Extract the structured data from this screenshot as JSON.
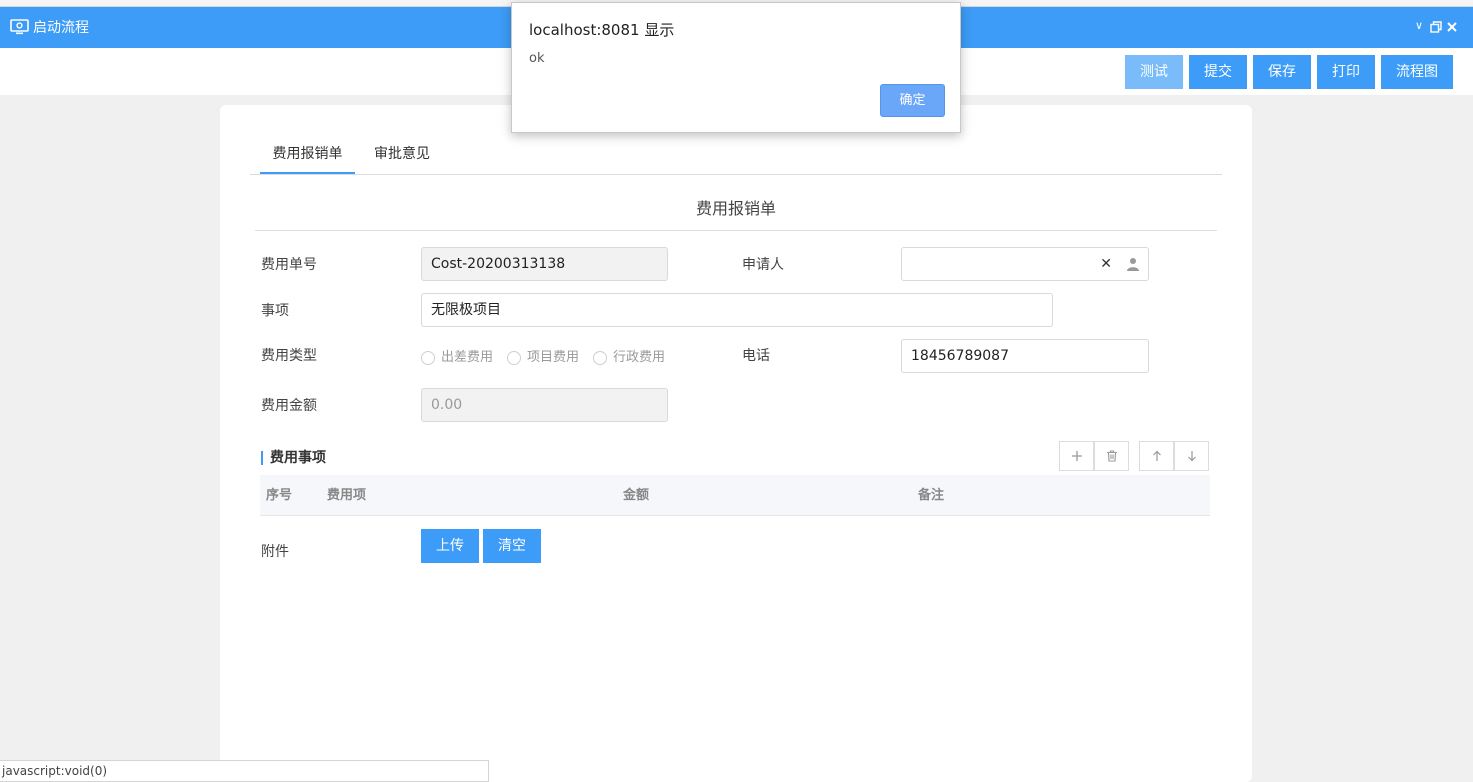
{
  "window": {
    "title": "启动流程",
    "colors": {
      "accent": "#3d9cf7",
      "accent_light": "#79bcf9",
      "dialog_ok": "#6aa7f8"
    }
  },
  "toolbar": {
    "test_label": "测试",
    "submit_label": "提交",
    "save_label": "保存",
    "print_label": "打印",
    "flowchart_label": "流程图"
  },
  "tabs": [
    {
      "label": "费用报销单",
      "active": true
    },
    {
      "label": "审批意见",
      "active": false
    }
  ],
  "form": {
    "title": "费用报销单",
    "cost_no": {
      "label": "费用单号",
      "value": "Cost-20200313138"
    },
    "applicant": {
      "label": "申请人",
      "value": ""
    },
    "matter": {
      "label": "事项",
      "value": "无限极项目"
    },
    "cost_type": {
      "label": "费用类型",
      "options": [
        "出差费用",
        "项目费用",
        "行政费用"
      ]
    },
    "phone": {
      "label": "电话",
      "value": "18456789087"
    },
    "amount": {
      "label": "费用金额",
      "value": "0.00"
    }
  },
  "items_section": {
    "title": "费用事项",
    "columns": [
      "序号",
      "费用项",
      "金额",
      "备注"
    ],
    "rows": []
  },
  "attachment": {
    "label": "附件",
    "upload_label": "上传",
    "clear_label": "清空"
  },
  "dialog": {
    "title": "localhost:8081 显示",
    "message": "ok",
    "ok_label": "确定"
  },
  "statusbar": {
    "text": "javascript:void(0)"
  }
}
